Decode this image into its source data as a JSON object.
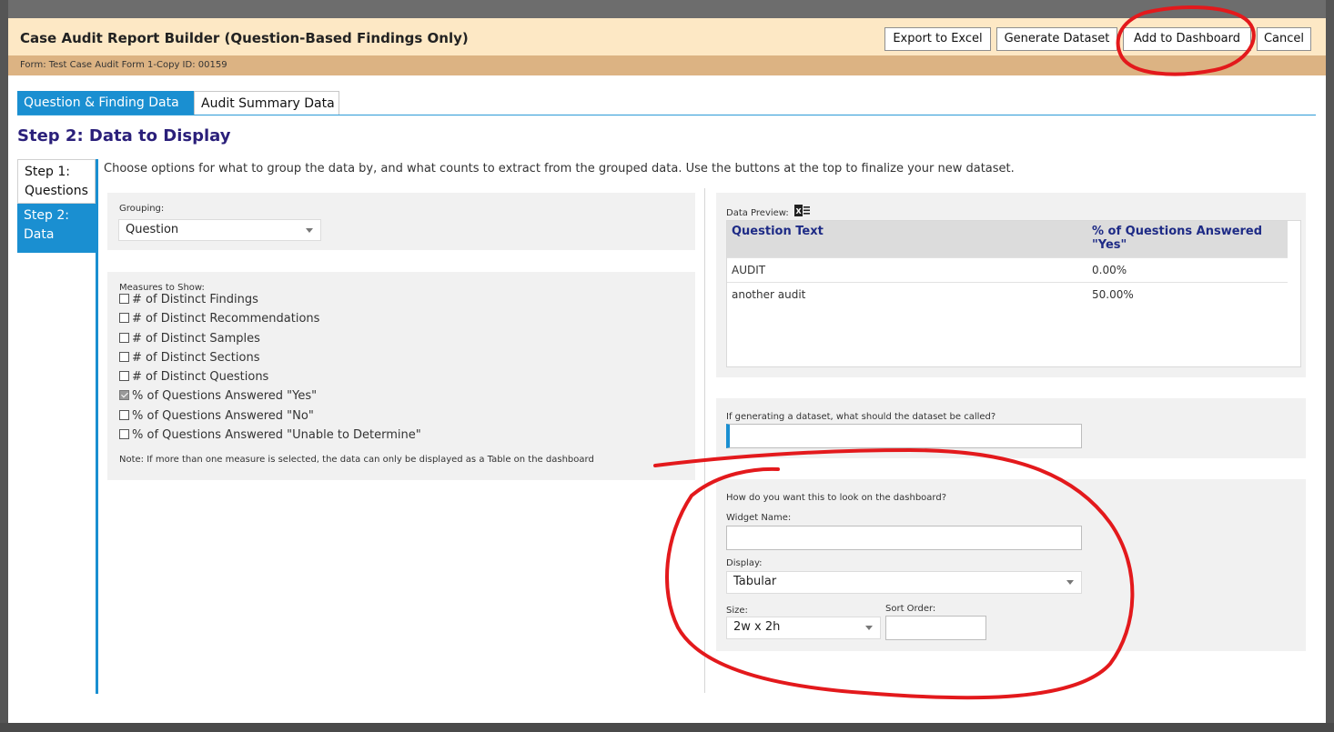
{
  "dialog": {
    "title": "Case Audit Report Builder (Question-Based Findings Only)",
    "toolbar": {
      "export_excel": "Export to Excel",
      "generate_dataset": "Generate Dataset",
      "add_dashboard": "Add to Dashboard",
      "cancel": "Cancel"
    },
    "subheader": "Form: Test Case Audit Form 1-Copy   ID: 00159"
  },
  "tabs": [
    {
      "label": "Question & Finding Data",
      "active": true
    },
    {
      "label": "Audit Summary Data",
      "active": false
    }
  ],
  "step_title": "Step 2: Data to Display",
  "steps": [
    {
      "label": "Step 1: Questions",
      "active": false
    },
    {
      "label": "Step 2: Data",
      "active": true
    }
  ],
  "instructions": "Choose options for what to group the data by, and what counts to extract from the grouped data. Use the buttons at the top to finalize your new dataset.",
  "grouping": {
    "label": "Grouping:",
    "value": "Question"
  },
  "measures": {
    "label": "Measures to Show:",
    "items": [
      {
        "label": "# of Distinct Findings",
        "checked": false
      },
      {
        "label": "# of Distinct Recommendations",
        "checked": false
      },
      {
        "label": "# of Distinct Samples",
        "checked": false
      },
      {
        "label": "# of Distinct Sections",
        "checked": false
      },
      {
        "label": "# of Distinct Questions",
        "checked": false
      },
      {
        "label": "% of Questions Answered \"Yes\"",
        "checked": true
      },
      {
        "label": "% of Questions Answered \"No\"",
        "checked": false
      },
      {
        "label": "% of Questions Answered \"Unable to Determine\"",
        "checked": false
      }
    ],
    "note": "Note: If more than one measure is selected, the data can only be displayed as a Table on the dashboard"
  },
  "preview": {
    "label": "Data Preview:",
    "columns": [
      "Question Text",
      "% of Questions Answered \"Yes\""
    ],
    "rows": [
      [
        "AUDIT",
        "0.00%"
      ],
      [
        "another audit",
        "50.00%"
      ]
    ]
  },
  "dataset": {
    "label": "If generating a dataset, what should the dataset be called?",
    "value": ""
  },
  "dashboard": {
    "question": "How do you want this to look on the dashboard?",
    "widget_name_label": "Widget Name:",
    "widget_name_value": "",
    "display_label": "Display:",
    "display_value": "Tabular",
    "size_label": "Size:",
    "size_value": "2w x 2h",
    "sort_label": "Sort Order:",
    "sort_value": ""
  },
  "colors": {
    "accent": "#1a8fd1",
    "titlebar": "#fde8c5",
    "subbar": "#dcb383",
    "annotation": "#e3191c"
  }
}
